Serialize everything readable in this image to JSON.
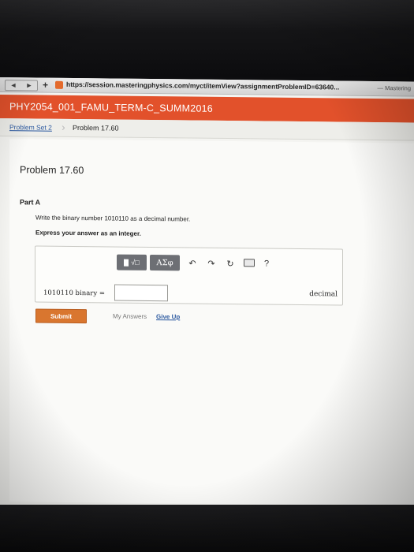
{
  "browser": {
    "url": "https://session.masteringphysics.com/myct/itemView?assignmentProblemID=63640...",
    "site_name": "— Mastering",
    "nav_back_icon": "back-arrow-icon",
    "nav_forward_icon": "forward-arrow-icon",
    "new_tab_label": "+",
    "favicon": "mastering-favicon"
  },
  "course": {
    "title": "PHY2054_001_FAMU_TERM-C_SUMM2016",
    "accent_color": "#e2512b"
  },
  "breadcrumb": {
    "parent": "Problem Set 2",
    "current": "Problem 17.60"
  },
  "problem": {
    "title": "Problem 17.60",
    "part": "Part A",
    "question": "Write the binary number 1010110 as a decimal number.",
    "instruction": "Express your answer as an integer."
  },
  "answer_tools": {
    "template_icon": "math-template-icon",
    "greek_label": "ΑΣφ",
    "undo_icon": "undo-icon",
    "redo_icon": "redo-icon",
    "reset_icon": "reset-icon",
    "keyboard_icon": "keyboard-icon",
    "help_label": "?"
  },
  "answer": {
    "prefix": "1010110 binary =",
    "value": "",
    "unit": "decimal"
  },
  "actions": {
    "submit_label": "Submit",
    "my_answers_label": "My Answers",
    "give_up_label": "Give Up",
    "submit_color": "#d9762f"
  }
}
